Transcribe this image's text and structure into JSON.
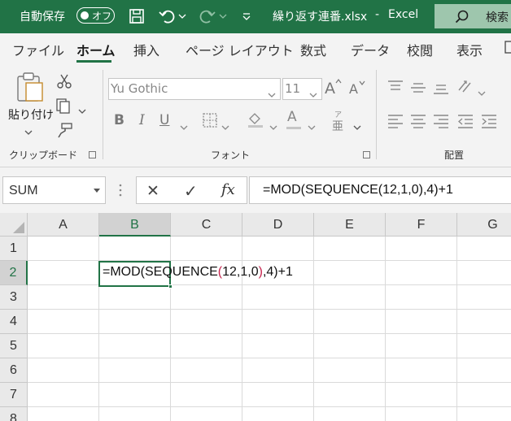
{
  "titlebar": {
    "autosave_label": "自動保存",
    "autosave_state": "オフ",
    "filename": "繰り返す連番.xlsx",
    "separator": "-",
    "app_name": "Excel",
    "search_label": "検索",
    "background_color": "#217346"
  },
  "ribbon_tabs": [
    "ファイル",
    "ホーム",
    "挿入",
    "ページ レイアウト",
    "数式",
    "データ",
    "校閲",
    "表示"
  ],
  "ribbon_active_tab": "ホーム",
  "ribbon": {
    "clipboard": {
      "paste_label": "貼り付け",
      "group_label": "クリップボード"
    },
    "font": {
      "font_name": "Yu Gothic",
      "font_size": "11",
      "bold": "B",
      "italic": "I",
      "underline": "U",
      "font_color_glyph": "A",
      "phonetic_glyph_top": "ア",
      "phonetic_glyph_bottom": "亜",
      "group_label": "フォント"
    },
    "alignment": {
      "group_label": "配置"
    }
  },
  "formula_bar": {
    "name_box": "SUM",
    "cancel_glyph": "✕",
    "enter_glyph": "✓",
    "fx_glyph": "fx",
    "formula": "=MOD(SEQUENCE(12,1,0),4)+1"
  },
  "grid": {
    "columns": [
      "A",
      "B",
      "C",
      "D",
      "E",
      "F",
      "G"
    ],
    "rows": [
      "1",
      "2",
      "3",
      "4",
      "5",
      "6",
      "7",
      "8"
    ],
    "selected_column": "B",
    "selected_row": "2",
    "active_cell_edit": {
      "part1": "=MOD(SEQUENCE",
      "open_paren": "(",
      "args": "12,1,0",
      "close_paren": ")",
      "part2": ",4)+1"
    },
    "accent_color": "#217346"
  }
}
